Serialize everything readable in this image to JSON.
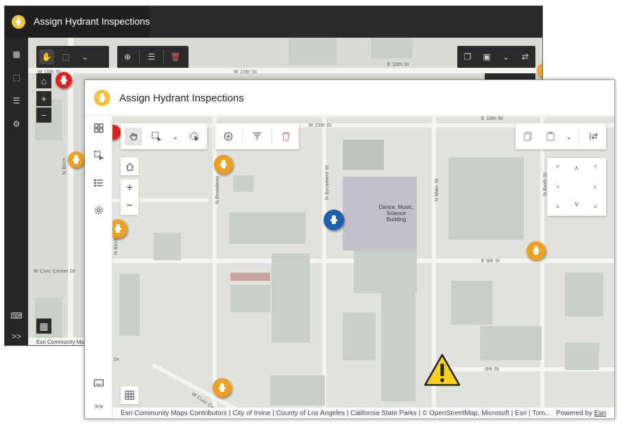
{
  "app": {
    "title": "Assign Hydrant Inspections",
    "logo_icon": "hydrant-logo-icon",
    "accent_color": "#f0c43c"
  },
  "back_window": {
    "title": "Assign Hydrant Inspections",
    "streets": [
      "W 10th St",
      "W 10th St",
      "E 10th St",
      "N Birch",
      "W Civic Center Dr"
    ],
    "attribution": "Esri Community Ma",
    "zoom_in": "+",
    "zoom_out": "−",
    "expand_label": ">>"
  },
  "front_window": {
    "sidebar": {
      "items": [
        {
          "icon": "layer-list-icon"
        },
        {
          "icon": "select-tool-icon"
        },
        {
          "icon": "list-icon"
        },
        {
          "icon": "settings-icon"
        }
      ],
      "keyboard_icon": "keyboard-icon",
      "expand_label": ">>"
    },
    "toolbar": {
      "tools": [
        "pan-tool-icon",
        "rectangle-select-icon",
        "chevron-down-icon",
        "lasso-select-icon"
      ],
      "actions": [
        "add-icon",
        "filter-icon",
        "delete-icon"
      ],
      "right_tools": [
        "copy-icon",
        "paste-icon",
        "chevron-down-icon",
        "swap-icon"
      ]
    },
    "zoom": {
      "in": "+",
      "out": "−"
    },
    "map": {
      "streets": [
        "W 10th St",
        "E 10th St",
        "N Broadway",
        "N Sycamore St",
        "N Main St",
        "N Bush St",
        "E 9th St",
        "8th St",
        "W Civic Center",
        "Dr",
        "N Birch"
      ],
      "building_label": "Dance, Music,\nScience\nBuilding"
    },
    "attribution": "Esri Community Maps Contributors | City of Irvine | County of Los Angeles | California State Parks | © OpenStreetMap, Microsoft | Esri | Tom...",
    "powered_by": "Powered by",
    "powered_by_link": "Esri"
  },
  "colors": {
    "hydrant_orange": "#f0a020",
    "hydrant_red": "#e02020",
    "hydrant_blue": "#1d5fb3",
    "warning_yellow": "#f5d21e"
  }
}
